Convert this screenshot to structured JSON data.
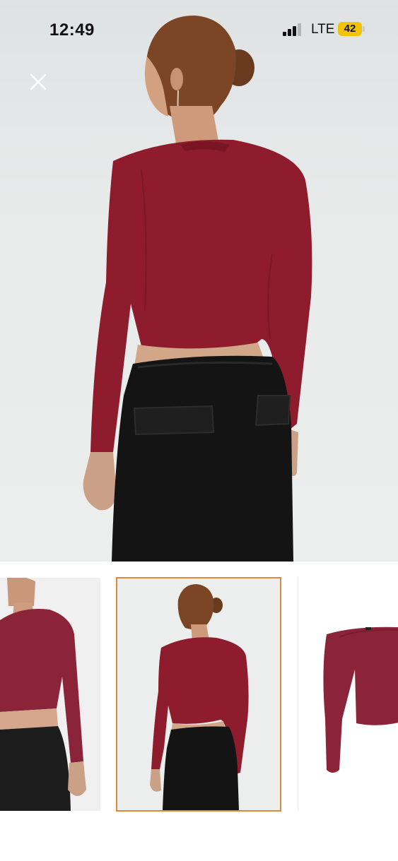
{
  "status_bar": {
    "time": "12:49",
    "carrier": "LTE",
    "battery": "42",
    "battery_color": "#f2c400"
  },
  "viewer": {
    "close_icon": "close-icon",
    "selected_index": 1,
    "accent_color": "#e2883a",
    "thumbnails": [
      {
        "name": "front-view"
      },
      {
        "name": "back-view"
      },
      {
        "name": "product-flat"
      }
    ],
    "garment_color": "#8e1c2c"
  }
}
